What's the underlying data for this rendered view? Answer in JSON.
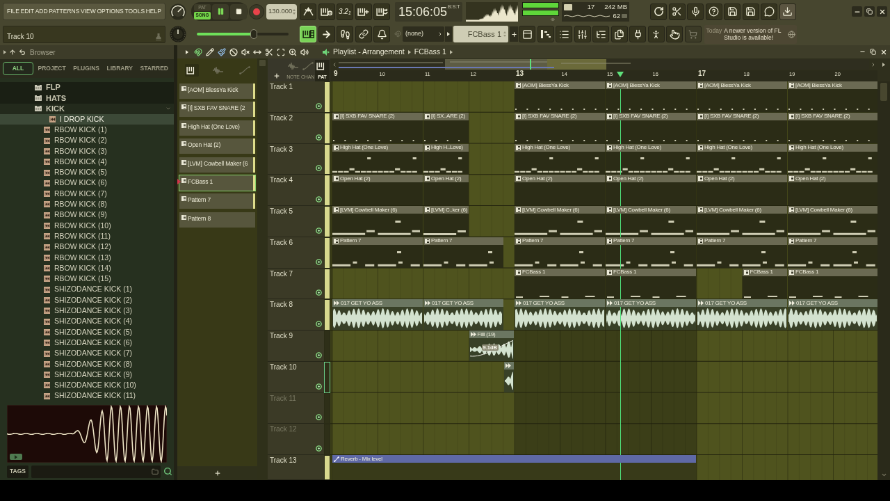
{
  "menu": [
    "FILE",
    "EDIT",
    "ADD",
    "PATTERNS",
    "VIEW",
    "OPTIONS",
    "TOOLS",
    "HELP"
  ],
  "hint_bar": {
    "text": "Track 10"
  },
  "transport": {
    "modes": [
      {
        "label": "PAT",
        "selected": false
      },
      {
        "label": "SONG",
        "selected": true
      }
    ],
    "playing": true,
    "tempo": "130.000"
  },
  "record_options": [
    {
      "kind": "metronome",
      "on": false
    },
    {
      "kind": "keys_clock",
      "on": false
    },
    {
      "kind": "countdown",
      "label": "3.2$_{1}$",
      "on": false
    },
    {
      "kind": "keys_plus",
      "on": false
    },
    {
      "kind": "keys_loop",
      "on": false
    }
  ],
  "clock": {
    "time": "15:06:05",
    "format": "B:S:T"
  },
  "output_meter": {
    "level": 1
  },
  "performance": {
    "readings": [
      "17",
      "242 MB",
      "62"
    ]
  },
  "master_pitch": {
    "level": 0.62
  },
  "edit_options": [
    {
      "kind": "keys_grid",
      "on": true
    },
    {
      "kind": "arrow",
      "on": false
    },
    {
      "kind": "footprints",
      "on": false
    },
    {
      "kind": "link",
      "on": false
    },
    {
      "kind": "bell",
      "on": false
    }
  ],
  "snap": {
    "value": "(none)"
  },
  "pattern_selector": {
    "value": "FCBass 1"
  },
  "news": {
    "date": "Today",
    "text": "A newer version of FL Studio is available!"
  },
  "browser": {
    "title": "Browser",
    "tabs": [
      {
        "label": "ALL",
        "selected": true
      },
      {
        "label": "PROJECT",
        "selected": false
      },
      {
        "label": "PLUGINS",
        "selected": false
      },
      {
        "label": "LIBRARY",
        "selected": false
      },
      {
        "label": "STARRED",
        "selected": false
      }
    ],
    "tree": [
      {
        "label": "FLP",
        "kind": "folder",
        "expanded": false,
        "selected": false
      },
      {
        "label": "HATS",
        "kind": "folder",
        "expanded": false,
        "selected": false
      },
      {
        "label": "KICK",
        "kind": "folder",
        "expanded": true,
        "selected": false,
        "children": [
          {
            "label": "I DROP KICK",
            "kind": "sample",
            "selected": true
          },
          {
            "label": "RBOW KICK (1)",
            "kind": "sample",
            "selected": false
          },
          {
            "label": "RBOW KICK (2)",
            "kind": "sample",
            "selected": false
          },
          {
            "label": "RBOW KICK (3)",
            "kind": "sample",
            "selected": false
          },
          {
            "label": "RBOW KICK (4)",
            "kind": "sample",
            "selected": false
          },
          {
            "label": "RBOW KICK (5)",
            "kind": "sample",
            "selected": false
          },
          {
            "label": "RBOW KICK (6)",
            "kind": "sample",
            "selected": false
          },
          {
            "label": "RBOW KICK (7)",
            "kind": "sample",
            "selected": false
          },
          {
            "label": "RBOW KICK (8)",
            "kind": "sample",
            "selected": false
          },
          {
            "label": "RBOW KICK (9)",
            "kind": "sample",
            "selected": false
          },
          {
            "label": "RBOW KICK (10)",
            "kind": "sample",
            "selected": false
          },
          {
            "label": "RBOW KICK (11)",
            "kind": "sample",
            "selected": false
          },
          {
            "label": "RBOW KICK (12)",
            "kind": "sample",
            "selected": false
          },
          {
            "label": "RBOW KICK (13)",
            "kind": "sample",
            "selected": false
          },
          {
            "label": "RBOW KICK (14)",
            "kind": "sample",
            "selected": false
          },
          {
            "label": "RBOW KICK (15)",
            "kind": "sample",
            "selected": false
          },
          {
            "label": "SHIZODANCE KICK (1)",
            "kind": "sample",
            "selected": false
          },
          {
            "label": "SHIZODANCE KICK (2)",
            "kind": "sample",
            "selected": false
          },
          {
            "label": "SHIZODANCE KICK (3)",
            "kind": "sample",
            "selected": false
          },
          {
            "label": "SHIZODANCE KICK (4)",
            "kind": "sample",
            "selected": false
          },
          {
            "label": "SHIZODANCE KICK (5)",
            "kind": "sample",
            "selected": false
          },
          {
            "label": "SHIZODANCE KICK (6)",
            "kind": "sample",
            "selected": false
          },
          {
            "label": "SHIZODANCE KICK (7)",
            "kind": "sample",
            "selected": false
          },
          {
            "label": "SHIZODANCE KICK (8)",
            "kind": "sample",
            "selected": false
          },
          {
            "label": "SHIZODANCE KICK (9)",
            "kind": "sample",
            "selected": false
          },
          {
            "label": "SHIZODANCE KICK (10)",
            "kind": "sample",
            "selected": false
          },
          {
            "label": "SHIZODANCE KICK (11)",
            "kind": "sample",
            "selected": false
          }
        ]
      }
    ],
    "tags": {
      "label": "TAGS"
    }
  },
  "playlist": {
    "title": "Playlist - Arrangement",
    "pattern": "FCBass 1",
    "picker_filters": [
      {
        "kind": "keys",
        "selected": true
      },
      {
        "kind": "wave",
        "selected": false
      },
      {
        "kind": "curve",
        "selected": false
      }
    ],
    "patterns": [
      {
        "name": "[AOM] BlessYa Kick",
        "selected": false,
        "used": true
      },
      {
        "name": "[I] SXB FAV SNARE (2",
        "selected": false,
        "used": true
      },
      {
        "name": "High Hat (One Love)",
        "selected": false,
        "used": true
      },
      {
        "name": "Open Hat (2)",
        "selected": false,
        "used": true
      },
      {
        "name": "[LVM] Cowbell Maker (6",
        "selected": false,
        "used": true
      },
      {
        "name": "FCBass 1",
        "selected": true,
        "used": true
      },
      {
        "name": "Pattern 7",
        "selected": false,
        "used": true
      },
      {
        "name": "Pattern 8",
        "selected": false,
        "used": false
      }
    ],
    "lanes": [
      {
        "kind": "wave",
        "label": "NOTE",
        "selected": false
      },
      {
        "kind": "curve",
        "label": "CHAN",
        "selected": false
      },
      {
        "kind": "keys",
        "label": "PAT",
        "selected": true
      }
    ],
    "ruler": [
      "9",
      "10",
      "11",
      "12",
      "13",
      "14",
      "15",
      "16",
      "17",
      "18",
      "19",
      "20"
    ],
    "tracks": [
      {
        "name": "Track 1",
        "selected": false,
        "dimmed": false,
        "clip_before": true,
        "clips": [
          {
            "kind": "pattern",
            "name": "[AOM] BlessYa Kick"
          },
          {
            "kind": "pattern",
            "name": "[AOM] BlessYa Kick"
          },
          {
            "kind": "pattern",
            "name": "[AOM] BlessYa Kick"
          },
          {
            "kind": "pattern",
            "name": "[AOM] BlessYa Kick"
          }
        ]
      },
      {
        "name": "Track 2",
        "selected": false,
        "dimmed": false,
        "clip_before": true,
        "clips": [
          {
            "kind": "pattern",
            "name": "[I] SXB FAV SNARE (2)"
          },
          {
            "kind": "pattern",
            "name": "[I] SX..ARE (2)"
          },
          {
            "kind": "pattern",
            "name": "[I] SXB FAV SNARE (2)"
          },
          {
            "kind": "pattern",
            "name": "[I] SXB FAV SNARE (2)"
          },
          {
            "kind": "pattern",
            "name": "[I] SXB FAV SNARE (2)"
          },
          {
            "kind": "pattern",
            "name": "[I] SXB FAV SNARE (2)"
          }
        ]
      },
      {
        "name": "Track 3",
        "selected": false,
        "dimmed": false,
        "clip_before": true,
        "clips": [
          {
            "kind": "pattern",
            "name": "High Hat (One Love)"
          },
          {
            "kind": "pattern",
            "name": "High H..Love)"
          },
          {
            "kind": "pattern",
            "name": "High Hat (One Love)"
          },
          {
            "kind": "pattern",
            "name": "High Hat (One Love)"
          },
          {
            "kind": "pattern",
            "name": "High Hat (One Love)"
          },
          {
            "kind": "pattern",
            "name": "High Hat (One Love)"
          }
        ]
      },
      {
        "name": "Track 4",
        "selected": false,
        "dimmed": false,
        "clip_before": true,
        "clips": [
          {
            "kind": "pattern",
            "name": "Open Hat (2)"
          },
          {
            "kind": "pattern",
            "name": "Open Hat (2)"
          },
          {
            "kind": "pattern",
            "name": "Open Hat (2)"
          },
          {
            "kind": "pattern",
            "name": "Open Hat (2)"
          },
          {
            "kind": "pattern",
            "name": "Open Hat (2)"
          },
          {
            "kind": "pattern",
            "name": "Open Hat (2)"
          }
        ]
      },
      {
        "name": "Track 5",
        "selected": false,
        "dimmed": false,
        "clip_before": true,
        "clips": [
          {
            "kind": "pattern",
            "name": "[LVM] Cowbell Maker (6)"
          },
          {
            "kind": "pattern",
            "name": "[LVM] C..ker (6)"
          },
          {
            "kind": "pattern",
            "name": "[LVM] Cowbell Maker (6)"
          },
          {
            "kind": "pattern",
            "name": "[LVM] Cowbell Maker (6)"
          },
          {
            "kind": "pattern",
            "name": "[LVM] Cowbell Maker (6)"
          },
          {
            "kind": "pattern",
            "name": "[LVM] Cowbell Maker (6)"
          }
        ]
      },
      {
        "name": "Track 6",
        "selected": false,
        "dimmed": false,
        "clip_before": true,
        "clips": [
          {
            "kind": "pattern",
            "name": "Pattern 7"
          },
          {
            "kind": "pattern",
            "name": "Pattern 7"
          },
          {
            "kind": "pattern",
            "name": "Pattern 7"
          },
          {
            "kind": "pattern",
            "name": "Pattern 7"
          },
          {
            "kind": "pattern",
            "name": "Pattern 7"
          },
          {
            "kind": "pattern",
            "name": "Pattern 7"
          }
        ]
      },
      {
        "name": "Track 7",
        "selected": false,
        "dimmed": false,
        "clip_before": true,
        "clips": [
          {
            "kind": "pattern",
            "name": "FCBass 1"
          },
          {
            "kind": "pattern",
            "name": "FCBass 1"
          },
          {
            "kind": "pattern",
            "name": "FCBass 1"
          },
          {
            "kind": "pattern",
            "name": "FCBass 1"
          }
        ]
      },
      {
        "name": "Track 8",
        "selected": false,
        "dimmed": false,
        "clip_before": true,
        "clips": [
          {
            "kind": "audio",
            "name": "017 GET YO ASS"
          },
          {
            "kind": "audio",
            "name": "017 GET YO ASS"
          },
          {
            "kind": "audio",
            "name": "017 GET YO ASS"
          },
          {
            "kind": "audio",
            "name": "017 GET YO ASS"
          },
          {
            "kind": "audio",
            "name": "017 GET YO ASS"
          },
          {
            "kind": "audio",
            "name": "017 GET YO ASS"
          }
        ]
      },
      {
        "name": "Track 9",
        "selected": false,
        "dimmed": false,
        "clip_before": false,
        "clips": [
          {
            "kind": "audio",
            "name": "Filll (19)",
            "badge": "9.1dB"
          }
        ]
      },
      {
        "name": "Track 10",
        "selected": true,
        "dimmed": false,
        "clip_before": false,
        "clips": [
          {
            "kind": "audio"
          }
        ]
      },
      {
        "name": "Track 11",
        "selected": false,
        "dimmed": true,
        "clip_before": false
      },
      {
        "name": "Track 12",
        "selected": false,
        "dimmed": true,
        "clip_before": false
      },
      {
        "name": "Track 13",
        "selected": false,
        "dimmed": false,
        "clip_before": true,
        "clips": [
          {
            "kind": "automation",
            "name": "Reverb - Mix level"
          }
        ]
      }
    ]
  }
}
